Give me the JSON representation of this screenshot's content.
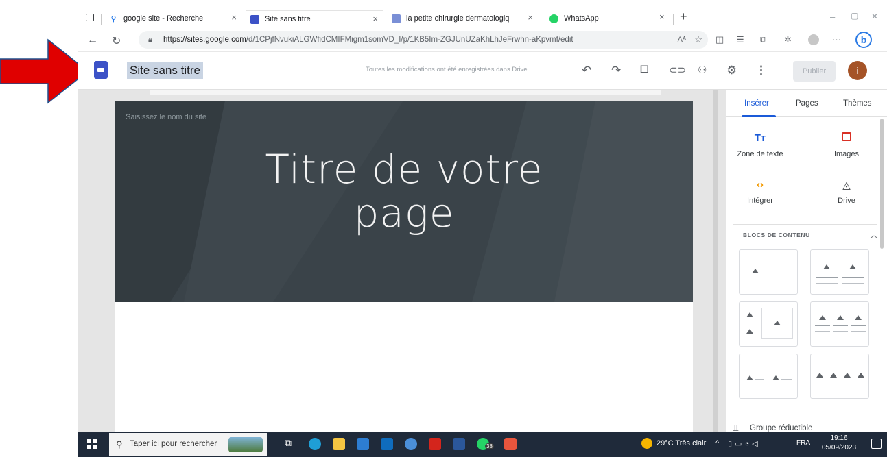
{
  "browser": {
    "tabs": [
      {
        "label": "google site - Recherche",
        "close": "×"
      },
      {
        "label": "Site sans titre",
        "close": "×"
      },
      {
        "label": "la petite chirurgie dermatologiq",
        "close": "×"
      },
      {
        "label": "WhatsApp",
        "close": "×"
      }
    ],
    "new_tab": "+",
    "url_domain": "https://sites.google.com",
    "url_path": "/d/1CPjfNvukiALGWfidCMIFMigm1somVD_I/p/1KB5Im-ZGJUnUZaKhLhJeFrwhn-aKpvmf/edit",
    "window_controls": {
      "minimize": "–",
      "maximize": "▢",
      "close": "✕"
    }
  },
  "editor": {
    "site_title": "Site sans titre",
    "saved_status": "Toutes les modifications ont été enregistrées dans Drive",
    "publish_label": "Publier",
    "avatar_letter": "i"
  },
  "page": {
    "site_name_placeholder": "Saisissez le nom du site",
    "page_title_line1": "Titre de votre",
    "page_title_line2": "page"
  },
  "panel": {
    "tabs": [
      "Insérer",
      "Pages",
      "Thèmes"
    ],
    "insert_items": [
      {
        "label": "Zone de texte",
        "icon": "text-box-icon"
      },
      {
        "label": "Images",
        "icon": "image-icon"
      },
      {
        "label": "Intégrer",
        "icon": "embed-icon"
      },
      {
        "label": "Drive",
        "icon": "drive-icon"
      }
    ],
    "insert_icon_glyphs": {
      "text": "Tт",
      "embed": "‹›",
      "drive": "◬"
    },
    "blocks_heading": "BLOCS DE CONTENU",
    "collapsible_group": "Groupe réductible"
  },
  "taskbar": {
    "search_placeholder": "Taper ici pour rechercher",
    "whatsapp_badge": "38",
    "weather": "29°C  Très clair",
    "language": "FRA",
    "time": "19:16",
    "date": "05/09/2023"
  },
  "colors": {
    "annotation_arrow": "#e00000",
    "accent": "#1a5ad8",
    "hero_background": "#3a4349",
    "avatar": "#a55327"
  }
}
